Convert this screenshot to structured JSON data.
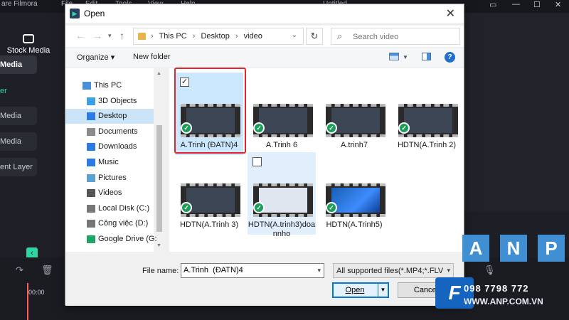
{
  "app": {
    "title_fragment": "are Filmora",
    "menu": [
      "File",
      "Edit",
      "Tools",
      "View",
      "Help"
    ],
    "project_title": "Untitled",
    "stock_media": "Stock Media",
    "side_items": [
      "Media",
      "er",
      "Media",
      "Media",
      "ent Layer"
    ],
    "timeline_time": "00:00"
  },
  "dialog": {
    "title": "Open",
    "close_glyph": "✕",
    "breadcrumb": [
      "This PC",
      "Desktop",
      "video"
    ],
    "search_placeholder": "Search video",
    "toolbar": {
      "organize": "Organize ▾",
      "new_folder": "New folder",
      "help": "?"
    },
    "nav": [
      {
        "label": "This PC",
        "icon": "computer-icon",
        "color": "#4a90d9"
      },
      {
        "label": "3D Objects",
        "icon": "cube-icon",
        "color": "#3aa0e0"
      },
      {
        "label": "Desktop",
        "icon": "desktop-icon",
        "color": "#2c7be5",
        "selected": true
      },
      {
        "label": "Documents",
        "icon": "document-icon",
        "color": "#8a8a8a"
      },
      {
        "label": "Downloads",
        "icon": "download-icon",
        "color": "#2c7be5"
      },
      {
        "label": "Music",
        "icon": "music-icon",
        "color": "#2c7be5"
      },
      {
        "label": "Pictures",
        "icon": "picture-icon",
        "color": "#5aa0d0"
      },
      {
        "label": "Videos",
        "icon": "video-icon",
        "color": "#555"
      },
      {
        "label": "Local Disk (C:)",
        "icon": "disk-icon",
        "color": "#777"
      },
      {
        "label": "Công việc (D:)",
        "icon": "disk-icon",
        "color": "#777"
      },
      {
        "label": "Google Drive (G:",
        "icon": "google-drive-icon",
        "color": "#1ea362"
      }
    ],
    "files": [
      {
        "name": "A.Trinh  (ĐATN)4",
        "selected": true,
        "checked": true,
        "style": "dark"
      },
      {
        "name": "A.Trinh 6",
        "style": "dark"
      },
      {
        "name": "A.trinh7",
        "style": "dark"
      },
      {
        "name": "HDTN(A.Trinh 2)",
        "style": "dark"
      },
      {
        "name": "HDTN(A.Trinh 3)",
        "style": "dark"
      },
      {
        "name": "HDTN(A.trinh3)doannho",
        "hover": true,
        "style": "light"
      },
      {
        "name": "HDTN(A.Trinh5)",
        "style": "win"
      }
    ],
    "footer": {
      "file_name_label": "File name:",
      "file_name_value": "A.Trinh  (ĐATN)4",
      "file_type": "All supported files(*.MP4;*.FLV;*",
      "open": "Open",
      "cancel": "Cancel"
    }
  },
  "watermark": {
    "letters": [
      "A",
      "N",
      "P"
    ],
    "logo": "F",
    "phone": "098 7798 772",
    "url": "WWW.ANP.COM.VN"
  },
  "colors": {
    "highlight": "#e0262a",
    "selection": "#cce8ff",
    "accent": "#0078d4",
    "brand_green": "#2fd6a0"
  }
}
